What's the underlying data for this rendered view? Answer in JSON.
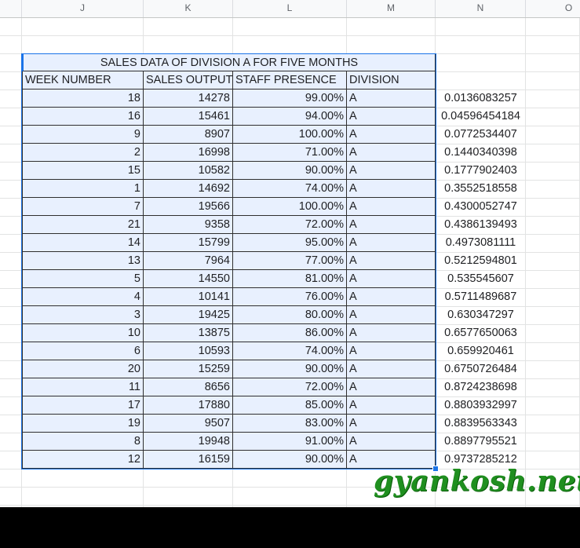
{
  "columns": [
    "J",
    "K",
    "L",
    "M",
    "N",
    "O"
  ],
  "table": {
    "title": "SALES DATA OF DIVISION A FOR FIVE MONTHS",
    "headers": [
      "WEEK NUMBER",
      "SALES OUTPUT",
      "STAFF PRESENCE",
      "DIVISION"
    ],
    "rows": [
      [
        "18",
        "14278",
        "99.00%",
        "A",
        "0.0136083257"
      ],
      [
        "16",
        "15461",
        "94.00%",
        "A",
        "0.04596454184"
      ],
      [
        "9",
        "8907",
        "100.00%",
        "A",
        "0.0772534407"
      ],
      [
        "2",
        "16998",
        "71.00%",
        "A",
        "0.1440340398"
      ],
      [
        "15",
        "10582",
        "90.00%",
        "A",
        "0.1777902403"
      ],
      [
        "1",
        "14692",
        "74.00%",
        "A",
        "0.3552518558"
      ],
      [
        "7",
        "19566",
        "100.00%",
        "A",
        "0.4300052747"
      ],
      [
        "21",
        "9358",
        "72.00%",
        "A",
        "0.4386139493"
      ],
      [
        "14",
        "15799",
        "95.00%",
        "A",
        "0.4973081111"
      ],
      [
        "13",
        "7964",
        "77.00%",
        "A",
        "0.5212594801"
      ],
      [
        "5",
        "14550",
        "81.00%",
        "A",
        "0.535545607"
      ],
      [
        "4",
        "10141",
        "76.00%",
        "A",
        "0.5711489687"
      ],
      [
        "3",
        "19425",
        "80.00%",
        "A",
        "0.630347297"
      ],
      [
        "10",
        "13875",
        "86.00%",
        "A",
        "0.6577650063"
      ],
      [
        "6",
        "10593",
        "74.00%",
        "A",
        "0.659920461"
      ],
      [
        "20",
        "15259",
        "90.00%",
        "A",
        "0.6750726484"
      ],
      [
        "11",
        "8656",
        "72.00%",
        "A",
        "0.8724238698"
      ],
      [
        "17",
        "17880",
        "85.00%",
        "A",
        "0.8803932997"
      ],
      [
        "19",
        "9507",
        "83.00%",
        "A",
        "0.8839563343"
      ],
      [
        "8",
        "19948",
        "91.00%",
        "A",
        "0.8897795521"
      ],
      [
        "12",
        "16159",
        "90.00%",
        "A",
        "0.9737285212"
      ]
    ]
  },
  "watermark": "gyankosh.net",
  "colors": {
    "table_fill": "#e8f0fe",
    "selection": "#1a73e8",
    "watermark": "#1f8f1f"
  }
}
